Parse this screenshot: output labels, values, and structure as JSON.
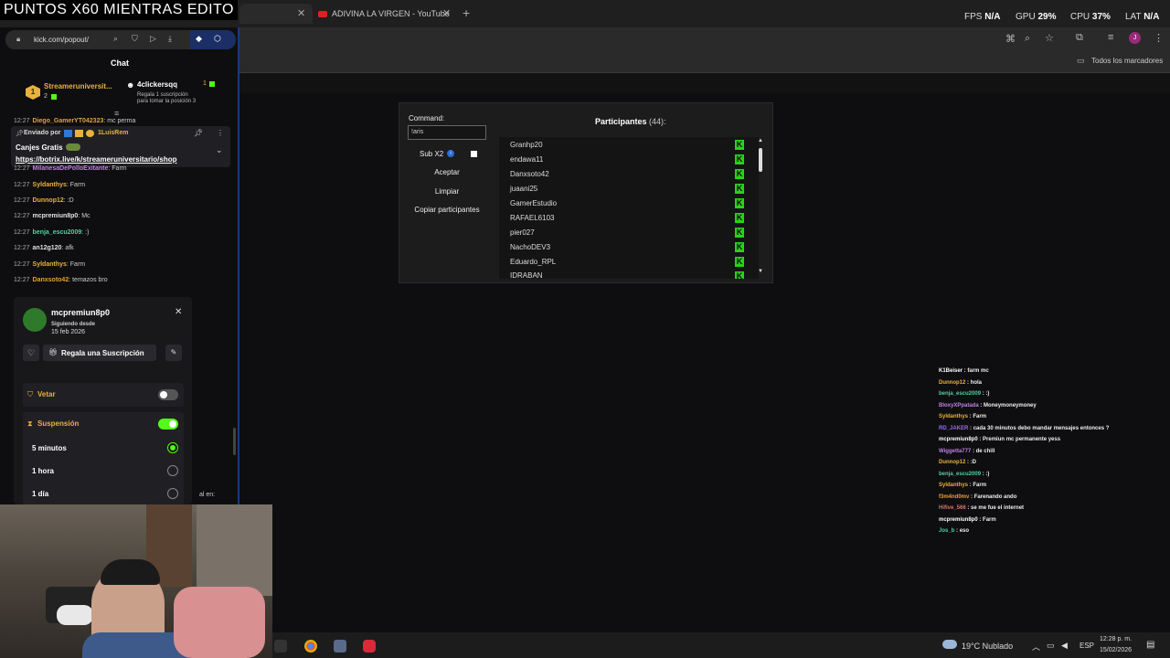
{
  "overlay_title": "PUNTOS X60 MIENTRAS EDITO",
  "browser": {
    "tab_youtube": "ADIVINA LA VIRGEN - YouTube",
    "new_tab": "+",
    "url": "kick.com/popout/",
    "bookmarks_label": "Todos los marcadores",
    "metrics": {
      "fps_label": "FPS",
      "fps_value": "N/A",
      "gpu_label": "GPU",
      "gpu_value": "29",
      "cpu_label": "CPU",
      "cpu_value": "37",
      "lat_label": "LAT",
      "lat_value": "N/A",
      "percent": "%"
    },
    "profile_initial": "J"
  },
  "chat": {
    "title": "Chat",
    "leader1": {
      "rank": "1",
      "name": "Streameruniversit...",
      "count": "2"
    },
    "leader2": {
      "name": "4clickersqq",
      "count": "1",
      "note_line1": "Regala 1 suscripción",
      "note_line2": "para tomar la posición 3"
    },
    "pinned": {
      "sent_by": "Enviado por",
      "sender": "1LuisRem",
      "title": "Canjes Gratis",
      "link": "https://botrix.live/k/streameruniversitario/shop"
    },
    "messages": [
      {
        "time": "12:27",
        "user": "Diego_GamerYT042323",
        "text": "mc perma",
        "color": "#e0a040"
      },
      {
        "time": "12:27",
        "user": "MilanesaDePolloExitante",
        "text": "Farm",
        "color": "#c080e0"
      },
      {
        "time": "12:27",
        "user": "Syldanthys",
        "text": "Farm",
        "color": "#e8b23a"
      },
      {
        "time": "12:27",
        "user": "Dunnop12",
        "text": ":D",
        "color": "#e8b23a"
      },
      {
        "time": "12:27",
        "user": "mcpremiun8p0",
        "text": "Mc",
        "color": "#e0e0e0"
      },
      {
        "time": "12:27",
        "user": "benja_escu2009",
        "text": ":)",
        "color": "#4fd1a0"
      },
      {
        "time": "12:27",
        "user": "an12g120",
        "text": "afk",
        "color": "#e0e0e0"
      },
      {
        "time": "12:27",
        "user": "Syldanthys",
        "text": "Farm",
        "color": "#e8b23a"
      },
      {
        "time": "12:27",
        "user": "Danxsoto42",
        "text": "temazos bro",
        "color": "#e8a030"
      }
    ],
    "trailing_text": "al en:"
  },
  "user_card": {
    "username": "mcpremiun8p0",
    "following_label": "Siguiendo desde",
    "following_date": "15 feb 2026",
    "gift_button": "Regala una Suscripción",
    "ban_label": "Vetar",
    "timeout_label": "Suspensión",
    "options": [
      "5 minutos",
      "1 hora",
      "1 día"
    ],
    "selected_option": 0,
    "ban_enabled": false,
    "timeout_enabled": true
  },
  "widget": {
    "command_label": "Command:",
    "command_value": "!aris",
    "sub_label": "Sub X2",
    "accept_button": "Aceptar",
    "clear_button": "Limpiar",
    "copy_button": "Copiar participantes",
    "participants_title": "Participantes",
    "participants_count": "(44):",
    "participants": [
      "Granhp20",
      "endawa11",
      "Danxsoto42",
      "juaani25",
      "GamerEstudio",
      "RAFAEL6103",
      "pier027",
      "NachoDEV3",
      "Eduardo_RPL",
      "IDRABAN"
    ],
    "badge_letter": "K"
  },
  "overlay_chat": [
    {
      "user": "K1Beiser",
      "text": "farm mc",
      "color": "#ffffff"
    },
    {
      "user": "Dunnop12",
      "text": "hola",
      "color": "#e8b23a"
    },
    {
      "user": "benja_escu2009",
      "text": ":)",
      "color": "#4fd1a0"
    },
    {
      "user": "BloxyXPpatada",
      "text": "Moneymoneymoney",
      "color": "#c080e0"
    },
    {
      "user": "Syldanthys",
      "text": "Farm",
      "color": "#e8b23a"
    },
    {
      "user": "RD_JAKER",
      "text": "cada 30 minutos debo mandar mensajes entonces ?",
      "color": "#9b6bff"
    },
    {
      "user": "mcpremiun8p0",
      "text": "Premiun mc permanente yess",
      "color": "#ffffff"
    },
    {
      "user": "Wiggetta777",
      "text": "de chill",
      "color": "#c080e0"
    },
    {
      "user": "Dunnop12",
      "text": ":D",
      "color": "#e8b23a"
    },
    {
      "user": "benja_escu2009",
      "text": ":)",
      "color": "#4fd1a0"
    },
    {
      "user": "Syldanthys",
      "text": "Farm",
      "color": "#e8b23a"
    },
    {
      "user": "f3m4nd0mv",
      "text": "Farenando ando",
      "color": "#e8a030"
    },
    {
      "user": "Hifive_566",
      "text": "se me fue el internet",
      "color": "#e07070"
    },
    {
      "user": "mcpremiun8p0",
      "text": "Farm",
      "color": "#ffffff"
    },
    {
      "user": "Jos_b",
      "text": "eso",
      "color": "#4fd1a0"
    }
  ],
  "taskbar": {
    "weather": "19°C Nublado",
    "lang": "ESP",
    "time": "12:28 p. m.",
    "date": "15/02/2026"
  },
  "colors": {
    "accent_green": "#53fc18",
    "kick_badge": "#2ad11a",
    "leader_gold": "#e8b23a"
  }
}
